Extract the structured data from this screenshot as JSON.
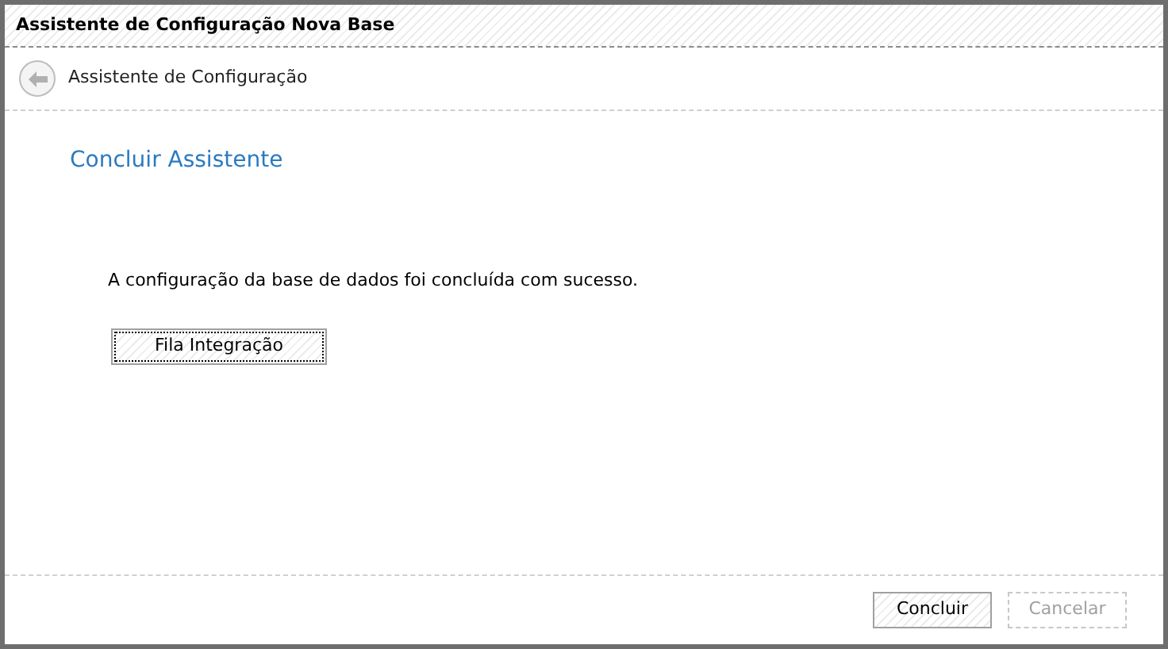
{
  "window": {
    "title": "Assistente de Configuração Nova Base"
  },
  "header": {
    "title": "Assistente de Configuração"
  },
  "page": {
    "heading": "Concluir Assistente",
    "message": "A configuração da base de dados foi concluída com sucesso.",
    "action_button": "Fila Integração"
  },
  "buttons": [
    {
      "label": "Concluir",
      "disabled": false
    },
    {
      "label": "Cancelar",
      "disabled": true
    }
  ]
}
